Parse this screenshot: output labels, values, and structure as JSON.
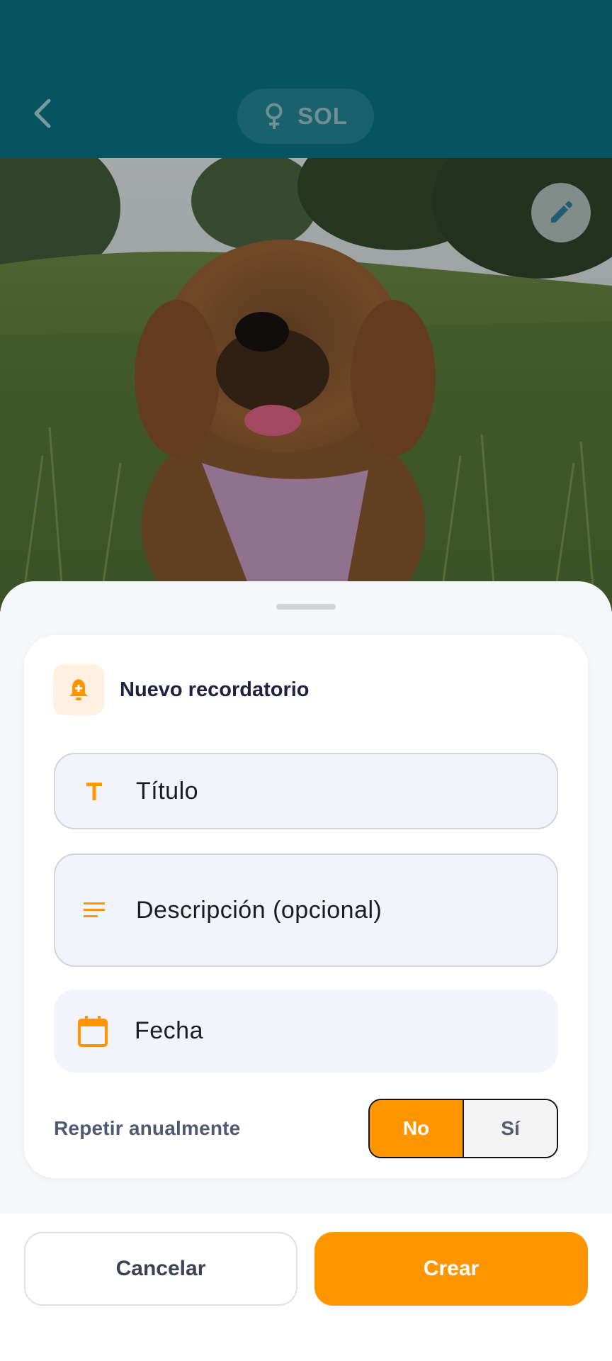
{
  "topbar": {
    "pet_name": "SOL",
    "gender_icon": "female-icon",
    "background_color": "#06545f"
  },
  "photo": {
    "description_icon": "edit-pencil-icon"
  },
  "reminder_form": {
    "header_icon": "bell-plus-icon",
    "title": "Nuevo recordatorio",
    "fields": {
      "title_placeholder": "Título",
      "description_placeholder": "Descripción (opcional)",
      "date_placeholder": "Fecha"
    },
    "repeat": {
      "label": "Repetir anualmente",
      "options": [
        "No",
        "Sí"
      ],
      "selected": "No"
    }
  },
  "actions": {
    "cancel_label": "Cancelar",
    "create_label": "Crear"
  },
  "colors": {
    "accent": "#ff9500",
    "field_background": "#f3f4fa",
    "title_text": "#1d2340"
  }
}
